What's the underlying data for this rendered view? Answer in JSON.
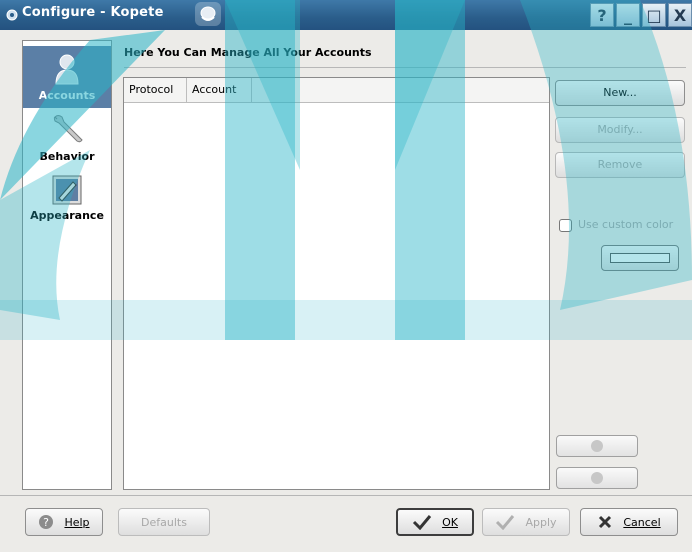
{
  "window": {
    "title": "Configure - Kopete",
    "buttons": [
      "?",
      "_",
      "□",
      "X"
    ]
  },
  "nav": {
    "items": [
      {
        "label": "Accounts",
        "icon": "accounts-icon",
        "active": true
      },
      {
        "label": "Behavior",
        "icon": "wrench-icon",
        "active": false
      },
      {
        "label": "Appearance",
        "icon": "appearance-icon",
        "active": false
      }
    ]
  },
  "accounts": {
    "heading": "Here You Can Manage All Your Accounts",
    "columns": [
      "Protocol",
      "Account"
    ],
    "rows": [],
    "buttons": {
      "new": "New...",
      "modify": "Modify...",
      "remove": "Remove"
    },
    "custom_color_label": "Use custom color"
  },
  "footer": {
    "help": "Help",
    "defaults": "Defaults",
    "ok": "OK",
    "apply": "Apply",
    "cancel": "Cancel"
  },
  "colors": {
    "titlebar": "#2a5d8a",
    "nav_active": "#5b7fa6",
    "window_bg": "#ecebe8"
  }
}
